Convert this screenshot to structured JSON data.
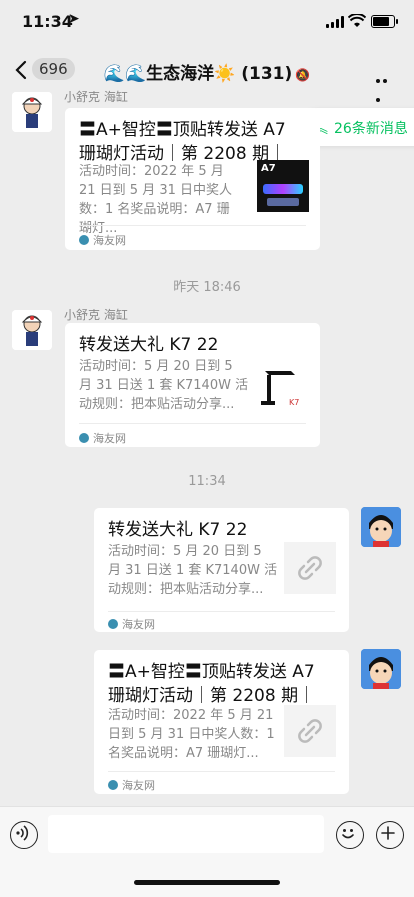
{
  "status_bar": {
    "time": "11:34",
    "location_glyph": "➤"
  },
  "header": {
    "back_badge": "696",
    "title": "🌊🌊生态海洋☀️ (131)",
    "mute_glyph": "🔕"
  },
  "new_messages": {
    "label": "26条新消息"
  },
  "messages": [
    {
      "sender": "小舒克 海缸",
      "title": "〓A+智控〓顶贴转发送 A7 珊瑚灯活动｜第 2208 期｜",
      "desc": "活动时间：2022 年 5 月 21 日到 5 月 31 日中奖人数：1 名奖品说明：A7 珊瑚灯...",
      "source": "海友网"
    },
    {
      "sender": "小舒克 海缸",
      "title": "转发送大礼 K7 22",
      "desc": "活动时间：5 月 20 日到 5 月 31 日送 1 套 K7140W 活动规则：把本贴活动分享...",
      "source": "海友网"
    },
    {
      "title": "转发送大礼 K7 22",
      "desc": "活动时间：5 月 20 日到 5 月 31 日送 1 套 K7140W 活动规则：把本贴活动分享...",
      "source": "海友网"
    },
    {
      "title": "〓A+智控〓顶贴转发送 A7 珊瑚灯活动｜第 2208 期｜",
      "desc": "活动时间：2022 年 5 月 21 日到 5 月 31 日中奖人数：1 名奖品说明：A7 珊瑚灯...",
      "source": "海友网"
    }
  ],
  "timestamps": [
    "昨天 18:46",
    "11:34"
  ],
  "thumb_text": {
    "a7": "A7"
  },
  "colors": {
    "accent": "#07c160",
    "background": "#ededed"
  }
}
